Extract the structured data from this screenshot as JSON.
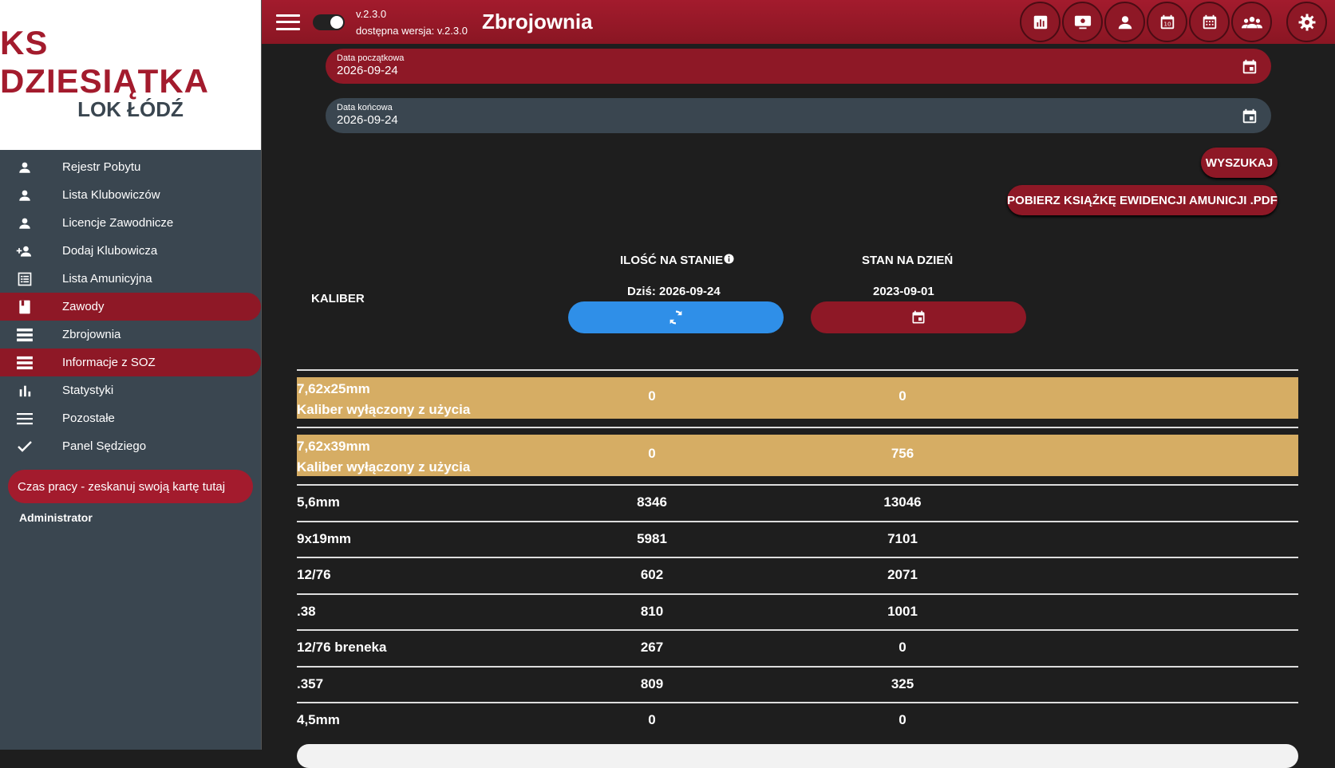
{
  "logo": {
    "line1": "KS DZIESIĄTKA",
    "line2": "LOK ŁÓDŹ"
  },
  "sidebar": {
    "items": [
      {
        "label": "Rejestr Pobytu",
        "icon": "person-icon",
        "active": false
      },
      {
        "label": "Lista Klubowiczów",
        "icon": "person-icon",
        "active": false
      },
      {
        "label": "Licencje Zawodnicze",
        "icon": "person-icon",
        "active": false
      },
      {
        "label": "Dodaj Klubowicza",
        "icon": "person-add-icon",
        "active": false
      },
      {
        "label": "Lista Amunicyjna",
        "icon": "list-icon",
        "active": false
      },
      {
        "label": "Zawody",
        "icon": "book-icon",
        "active": true
      },
      {
        "label": "Zbrojownia",
        "icon": "rows-icon",
        "active": false
      },
      {
        "label": "Informacje z SOZ",
        "icon": "rows-icon",
        "active": true
      },
      {
        "label": "Statystyki",
        "icon": "bar-chart-icon",
        "active": false
      },
      {
        "label": "Pozostałe",
        "icon": "menu-icon",
        "active": false
      },
      {
        "label": "Panel Sędziego",
        "icon": "check-icon",
        "active": false
      }
    ],
    "work_button": "Czas pracy - zeskanuj swoją kartę tutaj",
    "user": "Administrator"
  },
  "header": {
    "version": "v.2.3.0",
    "available_version": "dostępna wersja: v.2.3.0",
    "title": "Zbrojownia"
  },
  "filters": {
    "start_label": "Data początkowa",
    "start_value": "2026-09-24",
    "end_label": "Data końcowa",
    "end_value": "2026-09-24",
    "search_button": "WYSZUKAJ",
    "pdf_button": "POBIERZ KSIĄŻKĘ EWIDENCJI AMUNICJI .PDF"
  },
  "table": {
    "col_caliber": "KALIBER",
    "col_stock": "ILOŚĆ NA STANIE",
    "stock_date": "Dziś: 2026-09-24",
    "col_state": "STAN NA DZIEŃ",
    "state_date": "2023-09-01",
    "rows": [
      {
        "caliber": "7,62x25mm",
        "note": "Kaliber wyłączony z użycia",
        "stock": "0",
        "state": "0"
      },
      {
        "caliber": "7,62x39mm",
        "note": "Kaliber wyłączony z użycia",
        "stock": "0",
        "state": "756"
      },
      {
        "caliber": "5,6mm",
        "stock": "8346",
        "state": "13046"
      },
      {
        "caliber": "9x19mm",
        "stock": "5981",
        "state": "7101"
      },
      {
        "caliber": "12/76",
        "stock": "602",
        "state": "2071"
      },
      {
        "caliber": ".38",
        "stock": "810",
        "state": "1001"
      },
      {
        "caliber": "12/76 breneka",
        "stock": "267",
        "state": "0"
      },
      {
        "caliber": ".357",
        "stock": "809",
        "state": "325"
      },
      {
        "caliber": "4,5mm",
        "stock": "0",
        "state": "0"
      }
    ]
  },
  "colors": {
    "accent": "#a31b2d",
    "sidebar": "#3a4650",
    "gold": "#d6ad64",
    "blue": "#2f8fe8"
  }
}
